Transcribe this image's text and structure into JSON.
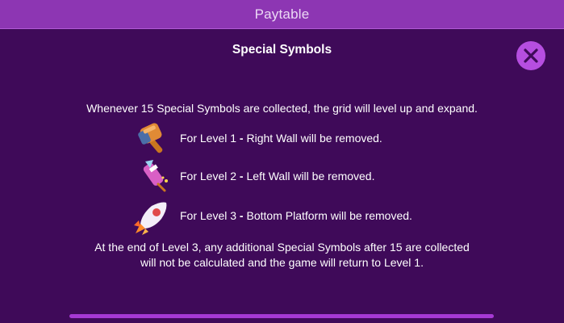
{
  "header": {
    "title": "Paytable"
  },
  "close_button": {
    "icon": "close-icon"
  },
  "section": {
    "title": "Special Symbols"
  },
  "intro": "Whenever 15 Special Symbols are collected, the grid will level up and expand.",
  "levels": [
    {
      "icon": "hammer-icon",
      "prefix": "For Level 1",
      "dash": " - ",
      "effect": "Right Wall will be removed."
    },
    {
      "icon": "firework-rocket-icon",
      "prefix": "For Level 2",
      "dash": " - ",
      "effect": "Left Wall will be removed."
    },
    {
      "icon": "rocket-icon",
      "prefix": "For Level 3",
      "dash": " - ",
      "effect": "Bottom Platform will be removed."
    }
  ],
  "outro": {
    "line1": "At the end of Level 3, any additional Special Symbols after 15 are collected",
    "line2": "will not be calculated and the game will return to Level 1."
  },
  "colors": {
    "background": "#3f0a59",
    "header": "#8d36b3",
    "close_button": "#b64ee0",
    "scrollbar": "#a639d4"
  }
}
